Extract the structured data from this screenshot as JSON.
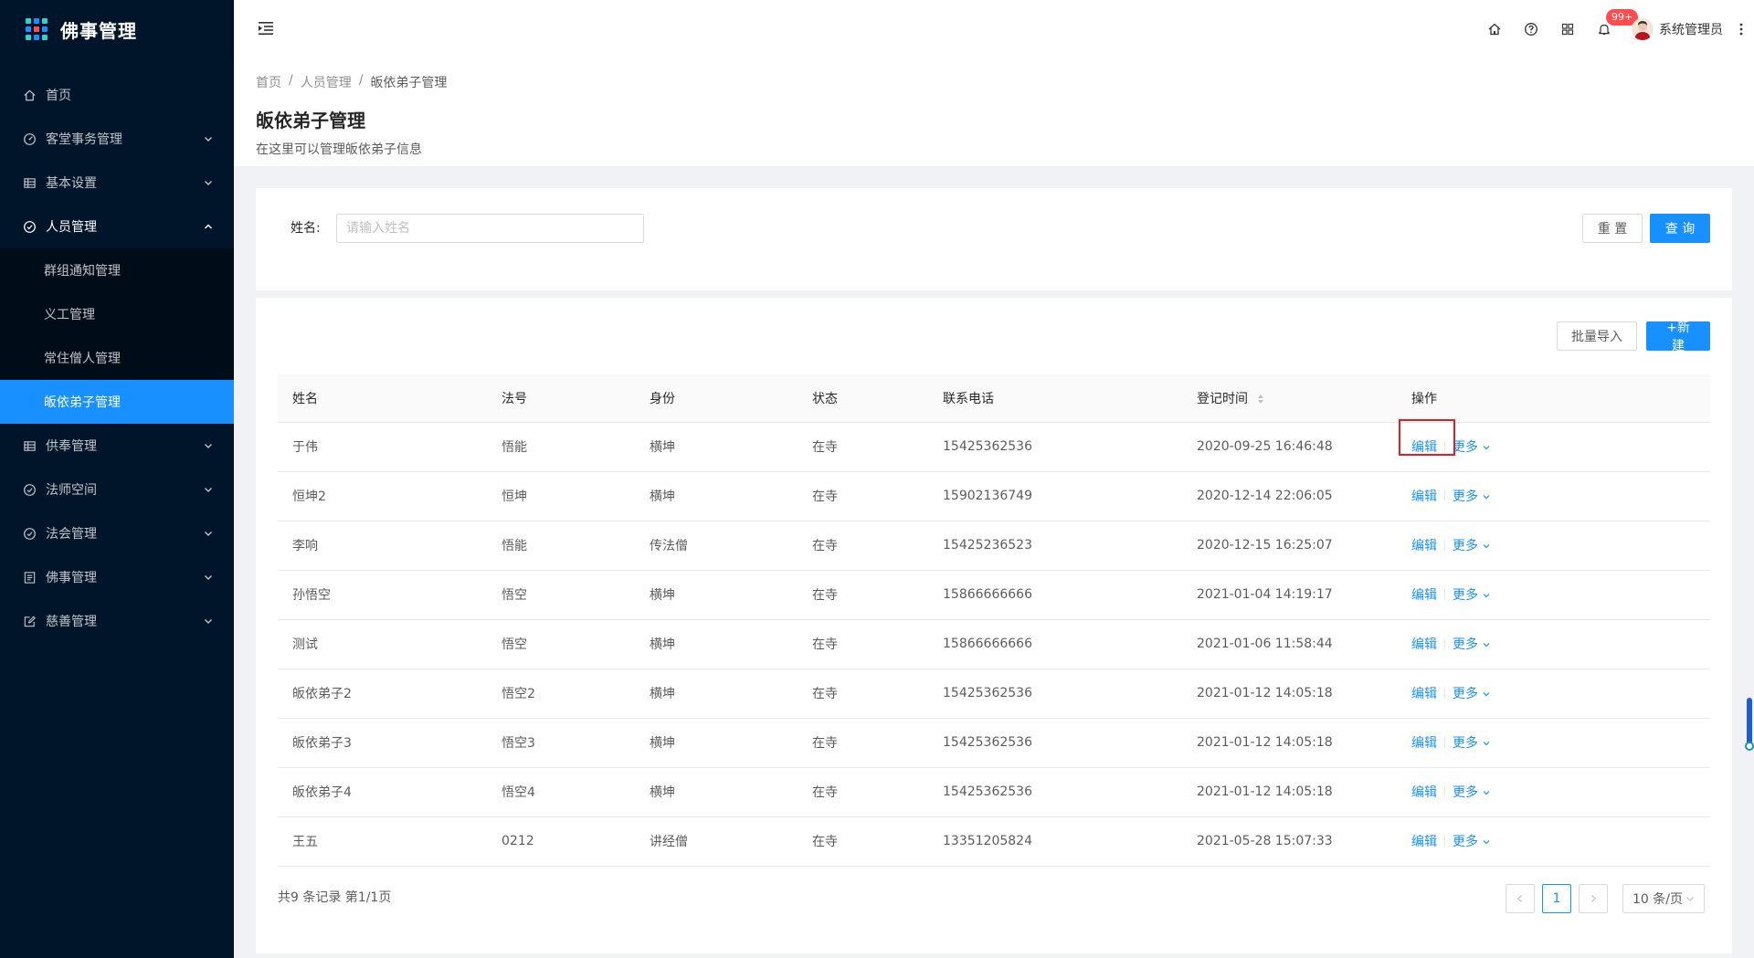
{
  "app": {
    "title": "佛事管理"
  },
  "sidebar": {
    "items": [
      {
        "label": "首页",
        "icon": "home-icon",
        "has_children": false
      },
      {
        "label": "客堂事务管理",
        "icon": "dashboard-icon",
        "has_children": true
      },
      {
        "label": "基本设置",
        "icon": "table-icon",
        "has_children": true
      },
      {
        "label": "人员管理",
        "icon": "check-circle-icon",
        "has_children": true,
        "open": true,
        "children": [
          {
            "label": "群组通知管理"
          },
          {
            "label": "义工管理"
          },
          {
            "label": "常住僧人管理"
          },
          {
            "label": "皈依弟子管理",
            "active": true
          }
        ]
      },
      {
        "label": "供奉管理",
        "icon": "table-icon",
        "has_children": true
      },
      {
        "label": "法师空间",
        "icon": "check-circle-icon",
        "has_children": true
      },
      {
        "label": "法会管理",
        "icon": "check-circle-icon",
        "has_children": true
      },
      {
        "label": "佛事管理",
        "icon": "profile-icon",
        "has_children": true
      },
      {
        "label": "慈善管理",
        "icon": "form-icon",
        "has_children": true
      }
    ]
  },
  "header": {
    "notification_badge": "99+",
    "user_name": "系统管理员"
  },
  "page": {
    "breadcrumb": [
      "首页",
      "人员管理",
      "皈依弟子管理"
    ],
    "title": "皈依弟子管理",
    "description": "在这里可以管理皈依弟子信息"
  },
  "search": {
    "label": "姓名:",
    "placeholder": "请输入姓名",
    "value": "",
    "reset_label": "重 置",
    "query_label": "查 询"
  },
  "toolbar": {
    "import_label": "批量导入",
    "new_label": "+新建"
  },
  "table": {
    "columns": [
      "姓名",
      "法号",
      "身份",
      "状态",
      "联系电话",
      "登记时间",
      "操作"
    ],
    "edit_label": "编辑",
    "more_label": "更多",
    "rows": [
      {
        "name": "于伟",
        "dharma": "悟能",
        "identity": "横坤",
        "status": "在寺",
        "phone": "15425362536",
        "time": "2020-09-25 16:46:48"
      },
      {
        "name": "恒坤2",
        "dharma": "恒坤",
        "identity": "横坤",
        "status": "在寺",
        "phone": "15902136749",
        "time": "2020-12-14 22:06:05"
      },
      {
        "name": "李响",
        "dharma": "悟能",
        "identity": "传法僧",
        "status": "在寺",
        "phone": "15425236523",
        "time": "2020-12-15 16:25:07"
      },
      {
        "name": "孙悟空",
        "dharma": "悟空",
        "identity": "横坤",
        "status": "在寺",
        "phone": "15866666666",
        "time": "2021-01-04 14:19:17"
      },
      {
        "name": "测试",
        "dharma": "悟空",
        "identity": "横坤",
        "status": "在寺",
        "phone": "15866666666",
        "time": "2021-01-06 11:58:44"
      },
      {
        "name": "皈依弟子2",
        "dharma": "悟空2",
        "identity": "横坤",
        "status": "在寺",
        "phone": "15425362536",
        "time": "2021-01-12 14:05:18"
      },
      {
        "name": "皈依弟子3",
        "dharma": "悟空3",
        "identity": "横坤",
        "status": "在寺",
        "phone": "15425362536",
        "time": "2021-01-12 14:05:18"
      },
      {
        "name": "皈依弟子4",
        "dharma": "悟空4",
        "identity": "横坤",
        "status": "在寺",
        "phone": "15425362536",
        "time": "2021-01-12 14:05:18"
      },
      {
        "name": "王五",
        "dharma": "0212",
        "identity": "讲经僧",
        "status": "在寺",
        "phone": "13351205824",
        "time": "2021-05-28 15:07:33"
      }
    ]
  },
  "pagination": {
    "total_text": "共9 条记录 第1/1页",
    "current_page": "1",
    "page_size": "10 条/页"
  },
  "colors": {
    "primary": "#1890ff",
    "sidebar": "#001529",
    "highlight": "#e02020"
  }
}
